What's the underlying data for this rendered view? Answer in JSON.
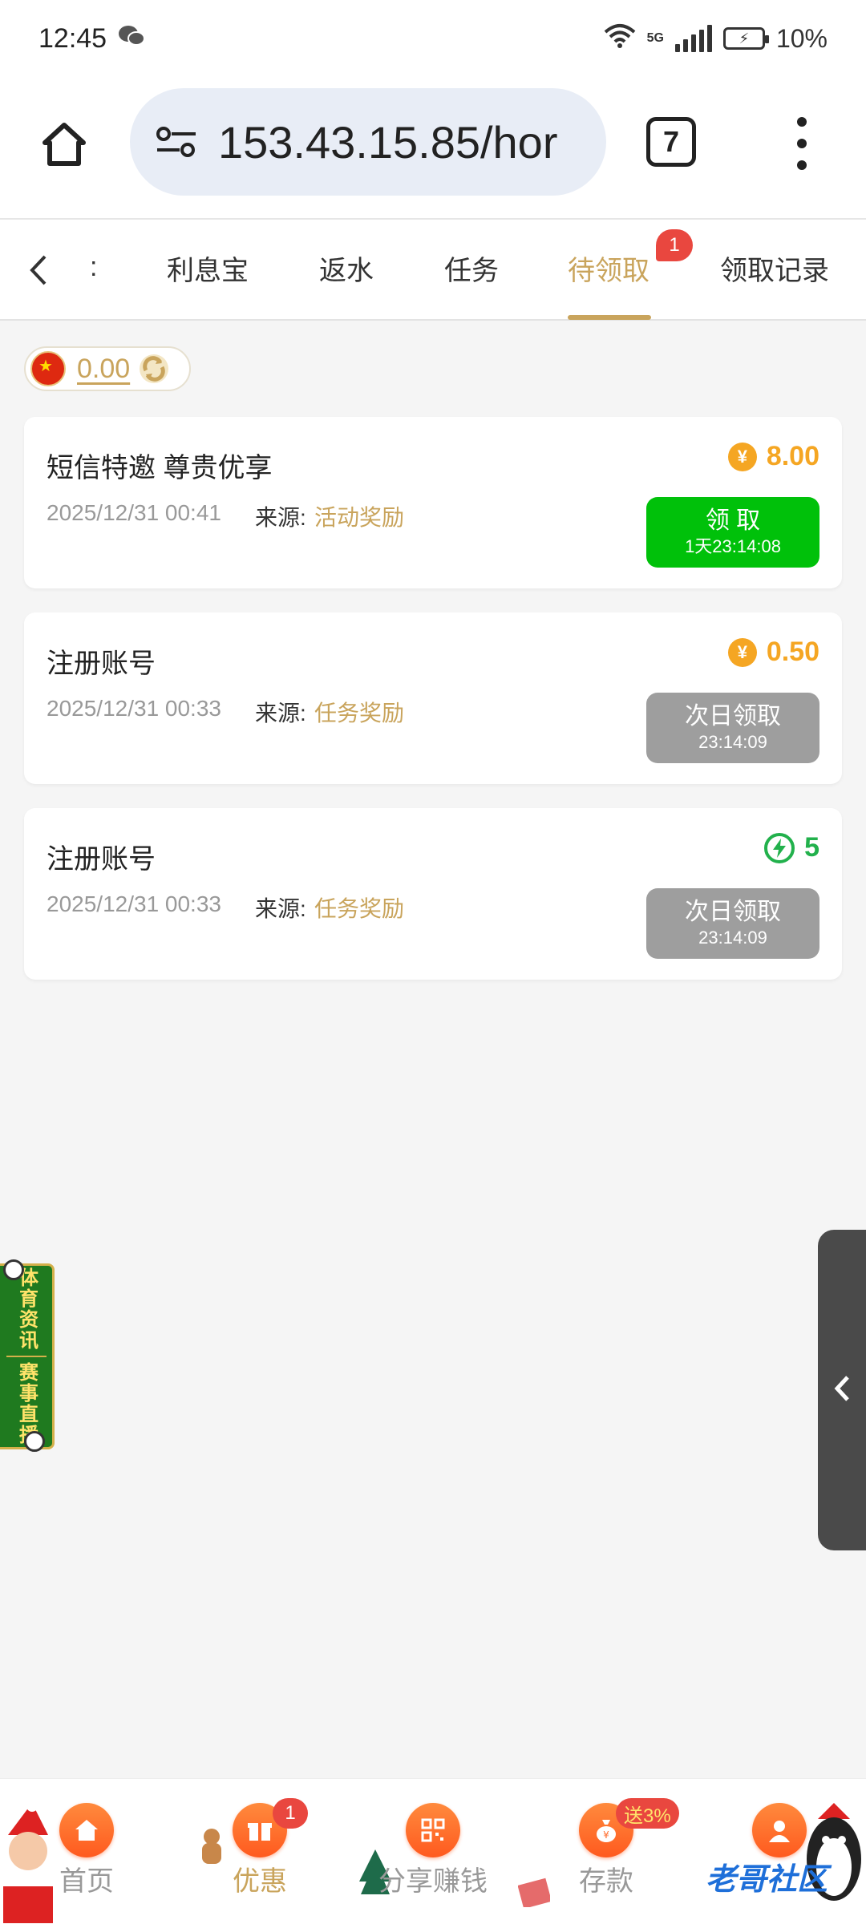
{
  "status_bar": {
    "time": "12:45",
    "network": "5G",
    "battery": "10%"
  },
  "browser": {
    "url": "153.43.15.85/hor",
    "tab_count": "7"
  },
  "tabs": {
    "items": [
      {
        "label": "利息宝"
      },
      {
        "label": "返水"
      },
      {
        "label": "任务"
      },
      {
        "label": "待领取",
        "active": true,
        "badge": "1"
      },
      {
        "label": "领取记录"
      }
    ]
  },
  "balance": {
    "amount": "0.00"
  },
  "rewards": [
    {
      "title": "短信特邀 尊贵优享",
      "date": "2025/12/31 00:41",
      "source_label": "来源:",
      "source": "活动奖励",
      "amount": "8.00",
      "reward_icon": "coin-icon",
      "button_label": "领 取",
      "button_sub": "1天23:14:08",
      "button_state": "claimable"
    },
    {
      "title": "注册账号",
      "date": "2025/12/31 00:33",
      "source_label": "来源:",
      "source": "任务奖励",
      "amount": "0.50",
      "reward_icon": "coin-icon",
      "button_label": "次日领取",
      "button_sub": "23:14:09",
      "button_state": "disabled"
    },
    {
      "title": "注册账号",
      "date": "2025/12/31 00:33",
      "source_label": "来源:",
      "source": "任务奖励",
      "amount": "5",
      "reward_icon": "bolt-icon",
      "button_label": "次日领取",
      "button_sub": "23:14:09",
      "button_state": "disabled"
    }
  ],
  "side_banner": {
    "line1": "体育资讯",
    "line2": "赛事直播"
  },
  "bottom_nav": {
    "items": [
      {
        "label": "首页",
        "icon": "home-icon"
      },
      {
        "label": "优惠",
        "icon": "gift-icon",
        "badge": "1",
        "active": true
      },
      {
        "label": "分享赚钱",
        "icon": "qr-icon"
      },
      {
        "label": "存款",
        "icon": "money-bag-icon",
        "badge": "送3%"
      },
      {
        "label": "",
        "icon": "user-icon"
      }
    ]
  },
  "watermark": "老哥社区",
  "colors": {
    "accent": "#c9a45c",
    "green": "#00c10a",
    "gray_button": "#9e9e9e",
    "badge": "#e9473f",
    "coin": "#f5a623",
    "bolt": "#22b14c"
  }
}
